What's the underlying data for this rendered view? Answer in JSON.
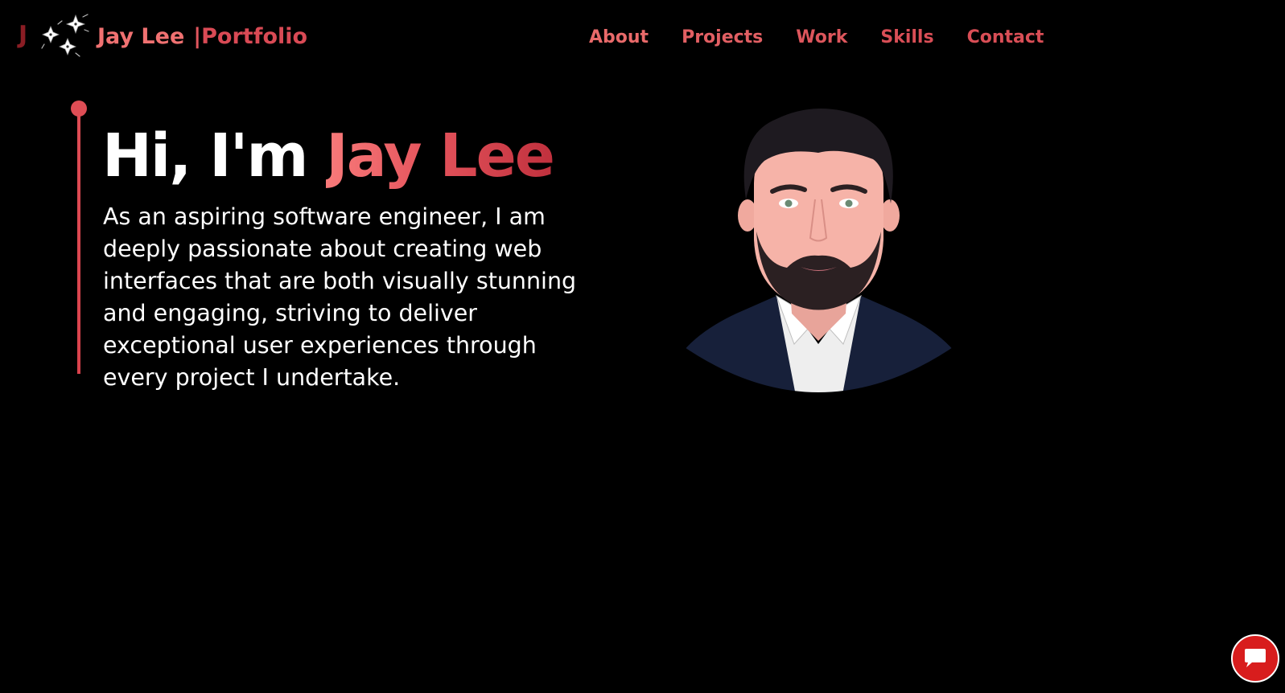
{
  "header": {
    "logo_letter": "J",
    "brand_name": "Jay Lee",
    "brand_separator": "|",
    "brand_suffix": "Portfolio",
    "logo_icon": "shuriken-icon"
  },
  "nav": {
    "items": [
      {
        "label": "About"
      },
      {
        "label": "Projects"
      },
      {
        "label": "Work"
      },
      {
        "label": "Skills"
      },
      {
        "label": "Contact"
      }
    ]
  },
  "hero": {
    "greeting": "Hi, I'm",
    "name": "Jay Lee",
    "description": "As an aspiring software engineer, I am deeply passionate about creating web interfaces that are both visually stunning and engaging, striving to deliver exceptional user experiences through every project I undertake.",
    "avatar_icon": "avatar-illustration"
  },
  "chat": {
    "icon": "chat-bubble-icon"
  },
  "colors": {
    "background": "#000000",
    "accent": "#e05560",
    "accent_dark": "#c0303d",
    "chat_button": "#d81d1d"
  }
}
